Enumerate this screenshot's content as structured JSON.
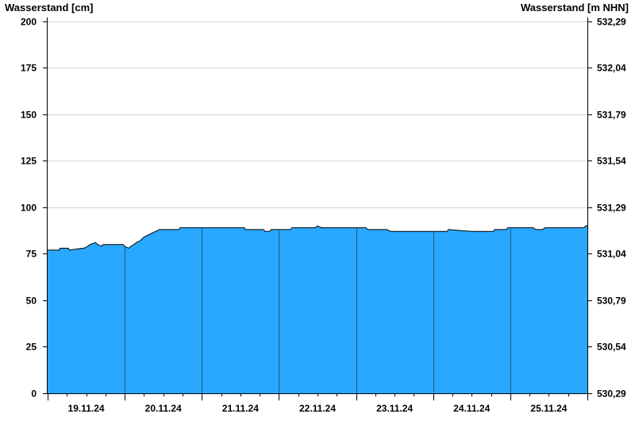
{
  "chart_data": {
    "type": "area",
    "title": "",
    "ylabel_left": "Wasserstand [cm]",
    "ylabel_right": "Wasserstand [m NHN]",
    "ylim": [
      0,
      202
    ],
    "yticks_left": [
      {
        "value": 0,
        "label": "0"
      },
      {
        "value": 25,
        "label": "25"
      },
      {
        "value": 50,
        "label": "50"
      },
      {
        "value": 75,
        "label": "75"
      },
      {
        "value": 100,
        "label": "100"
      },
      {
        "value": 125,
        "label": "125"
      },
      {
        "value": 150,
        "label": "150"
      },
      {
        "value": 175,
        "label": "175"
      },
      {
        "value": 200,
        "label": "200"
      }
    ],
    "yticks_right": [
      {
        "value": 0,
        "label": "530,29"
      },
      {
        "value": 25,
        "label": "530,54"
      },
      {
        "value": 50,
        "label": "530,79"
      },
      {
        "value": 75,
        "label": "531,04"
      },
      {
        "value": 100,
        "label": "531,29"
      },
      {
        "value": 125,
        "label": "531,54"
      },
      {
        "value": 150,
        "label": "531,79"
      },
      {
        "value": 175,
        "label": "532,04"
      },
      {
        "value": 200,
        "label": "532,29"
      }
    ],
    "xlim": [
      0,
      7
    ],
    "day_labels": [
      "19.11.24",
      "20.11.24",
      "21.11.24",
      "22.11.24",
      "23.11.24",
      "24.11.24",
      "25.11.24"
    ],
    "grid": true,
    "fill_color": "#29a8ff",
    "line_color": "#000000",
    "divider_color": "#1a5a8a",
    "series": [
      {
        "x": [
          0,
          0.15,
          0.16,
          0.27,
          0.28,
          0.45,
          0.47,
          0.52,
          0.55,
          0.62,
          0.65,
          0.7,
          0.72,
          0.98,
          1.0,
          1.05,
          1.08,
          1.12,
          1.15,
          1.2,
          1.25,
          1.3,
          1.35,
          1.4,
          1.45,
          1.5,
          1.7,
          1.72,
          2.0,
          2.55,
          2.57,
          2.8,
          2.82,
          2.88,
          2.9,
          3.0,
          3.15,
          3.17,
          3.47,
          3.5,
          3.55,
          4.0,
          4.13,
          4.15,
          4.4,
          4.45,
          5.0,
          5.18,
          5.2,
          5.5,
          5.78,
          5.8,
          5.95,
          5.97,
          6.3,
          6.33,
          6.42,
          6.45,
          6.95,
          6.98,
          7.0
        ],
        "y": [
          77,
          77,
          78,
          78,
          77,
          78,
          78,
          79,
          80,
          81,
          80,
          79,
          80,
          80,
          79,
          78,
          79,
          80,
          81,
          82,
          84,
          85,
          86,
          87,
          88,
          88,
          88,
          89,
          89,
          89,
          88,
          88,
          87,
          87,
          88,
          88,
          88,
          89,
          89,
          90,
          89,
          89,
          89,
          88,
          88,
          87,
          87,
          87,
          88,
          87,
          87,
          88,
          88,
          89,
          89,
          88,
          88,
          89,
          89,
          90,
          90
        ]
      }
    ]
  }
}
